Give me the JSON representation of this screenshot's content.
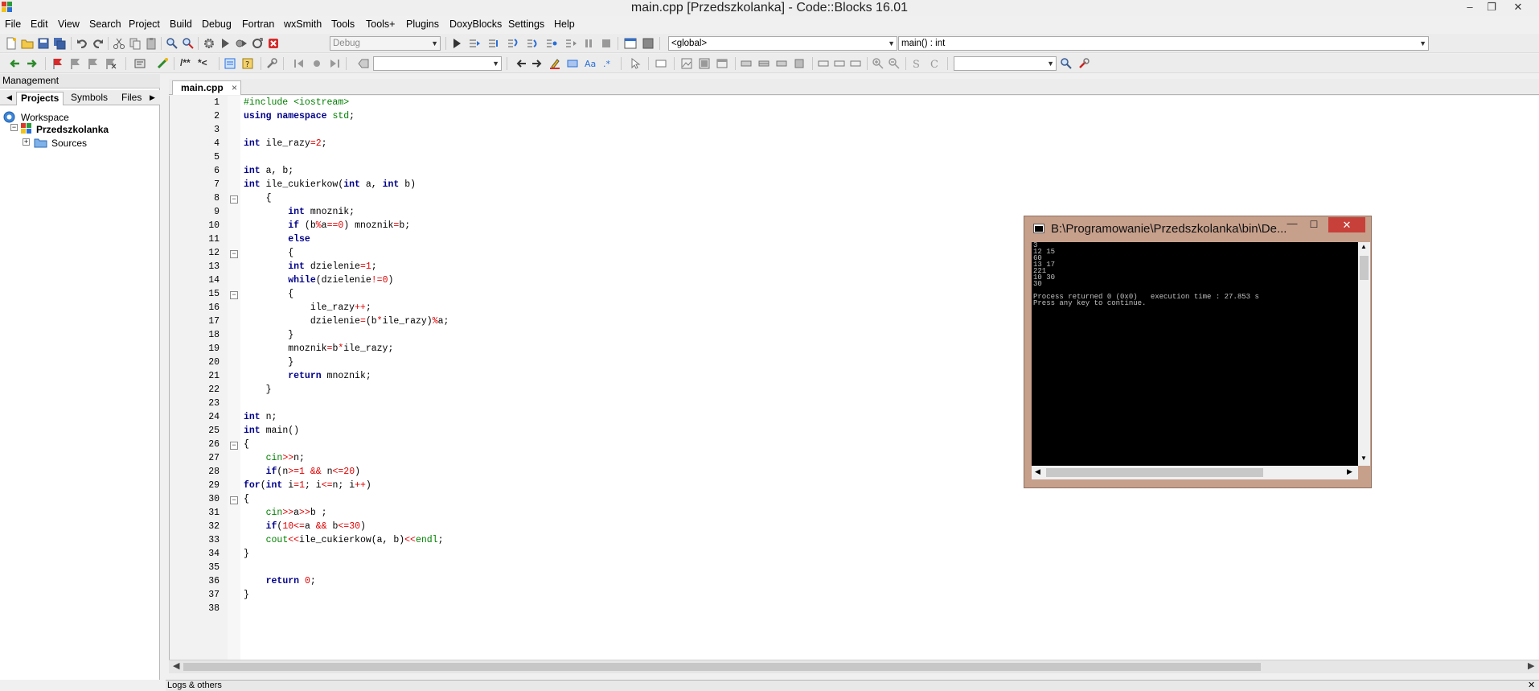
{
  "window": {
    "title": "main.cpp [Przedszkolanka] - Code::Blocks 16.01",
    "minimize": "–",
    "restore": "❐",
    "close": "✕"
  },
  "menu": [
    "File",
    "Edit",
    "View",
    "Search",
    "Project",
    "Build",
    "Debug",
    "Fortran",
    "wxSmith",
    "Tools",
    "Tools+",
    "Plugins",
    "DoxyBlocks",
    "Settings",
    "Help"
  ],
  "toolbar": {
    "build_target": "Debug",
    "scope": "<global>",
    "function": "main() : int",
    "doxy_block": "/**",
    "doxy_line": "*<"
  },
  "management": {
    "title": "Management",
    "tabs": [
      "Projects",
      "Symbols",
      "Files"
    ],
    "tree": {
      "workspace": "Workspace",
      "project": "Przedszkolanka",
      "sources": "Sources"
    }
  },
  "editor": {
    "tab": "main.cpp",
    "tab_close": "×",
    "lines": [
      "#include <iostream>",
      "using namespace std;",
      "",
      "int ile_razy=2;",
      "",
      "int a, b;",
      "int ile_cukierkow(int a, int b)",
      "    {",
      "        int mnoznik;",
      "        if (b%a==0) mnoznik=b;",
      "        else",
      "        {",
      "        int dzielenie=1;",
      "        while(dzielenie!=0)",
      "        {",
      "            ile_razy++;",
      "            dzielenie=(b*ile_razy)%a;",
      "        }",
      "        mnoznik=b*ile_razy;",
      "        }",
      "        return mnoznik;",
      "    }",
      "",
      "int n;",
      "int main()",
      "{",
      "    cin>>n;",
      "    if(n>=1 && n<=20)",
      "for(int i=1; i<=n; i++)",
      "{",
      "    cin>>a>>b ;",
      "    if(10<=a && b<=30)",
      "    cout<<ile_cukierkow(a, b)<<endl;",
      "}",
      "",
      "    return 0;",
      "}",
      ""
    ]
  },
  "logs": {
    "title": "Logs & others"
  },
  "console": {
    "title": "B:\\Programowanie\\Przedszkolanka\\bin\\De...",
    "output": "3\n12 15\n60\n13 17\n221\n10 30\n30\n\nProcess returned 0 (0x0)   execution time : 27.853 s\nPress any key to continue."
  },
  "colors": {
    "keyword": "#00008b",
    "preprocessor": "#008000",
    "operator": "#e00000",
    "console_frame": "#c7a08c",
    "console_close": "#c7403a"
  }
}
